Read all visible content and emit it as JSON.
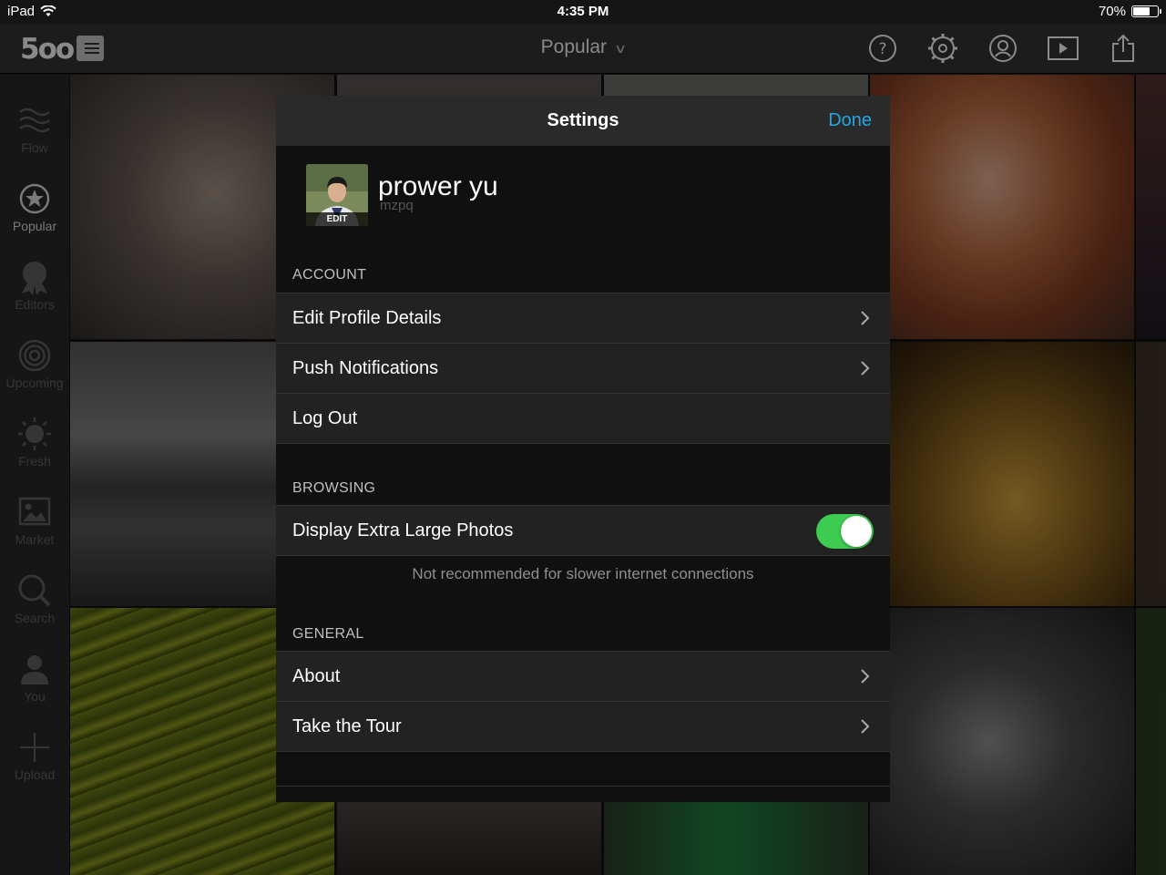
{
  "statusbar": {
    "device": "iPad",
    "time": "4:35 PM",
    "battery": "70%",
    "battery_level": 0.7
  },
  "topnav": {
    "logo": "5oo",
    "title": "Popular",
    "icons": [
      "help-icon",
      "settings-icon",
      "profile-icon",
      "slideshow-icon",
      "share-icon"
    ]
  },
  "sidebar": {
    "items": [
      {
        "label": "Flow",
        "icon": "flow-icon",
        "active": false
      },
      {
        "label": "Popular",
        "icon": "star-icon",
        "active": true
      },
      {
        "label": "Editors",
        "icon": "award-icon",
        "active": false
      },
      {
        "label": "Upcoming",
        "icon": "upcoming-icon",
        "active": false
      },
      {
        "label": "Fresh",
        "icon": "sun-icon",
        "active": false
      },
      {
        "label": "Market",
        "icon": "market-icon",
        "active": false
      },
      {
        "label": "Search",
        "icon": "search-icon",
        "active": false
      },
      {
        "label": "You",
        "icon": "user-icon",
        "active": false
      },
      {
        "label": "Upload",
        "icon": "plus-icon",
        "active": false
      }
    ]
  },
  "settings": {
    "title": "Settings",
    "done_label": "Done",
    "profile": {
      "name": "prower yu",
      "handle": "mzpq",
      "edit_label": "EDIT"
    },
    "account": {
      "header": "ACCOUNT",
      "items": [
        "Edit Profile Details",
        "Push Notifications",
        "Log Out"
      ]
    },
    "browsing": {
      "header": "BROWSING",
      "toggle_label": "Display Extra Large Photos",
      "toggle_on": true,
      "note": "Not recommended for slower internet connections"
    },
    "general": {
      "header": "GENERAL",
      "items": [
        "About",
        "Take the Tour"
      ]
    }
  },
  "colors": {
    "accent": "#21a8e6",
    "toggle_on": "#3ecb52"
  }
}
